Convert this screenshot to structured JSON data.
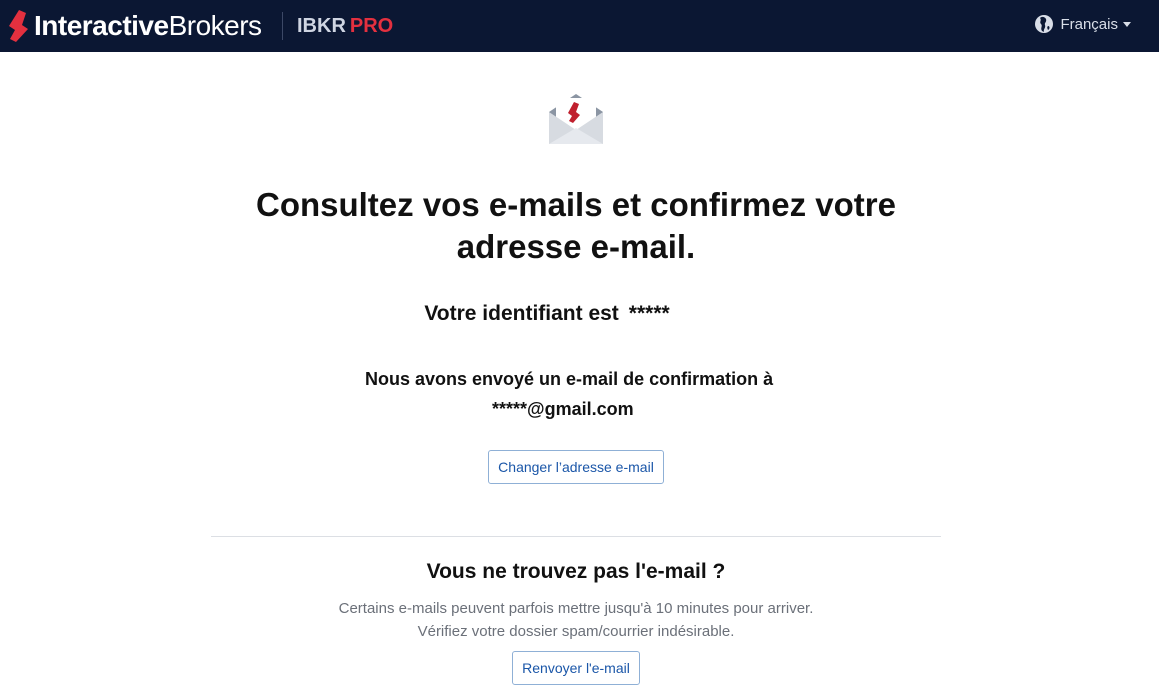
{
  "header": {
    "brand_bold": "Interactive",
    "brand_light": "Brokers",
    "product_name": "IBKR",
    "product_tier": "PRO",
    "language": "Français"
  },
  "main": {
    "headline_line1": "Consultez vos e-mails et confirmez votre",
    "headline_line2": "adresse e-mail.",
    "id_label": "Votre identifiant est",
    "id_value": "*****",
    "sent_text": "Nous avons envoyé un e-mail de confirmation à",
    "email": "*****@gmail.com",
    "change_email_label": "Changer l’adresse e-mail",
    "not_found_title": "Vous ne trouvez pas l'e-mail ?",
    "help_line1": "Certains e-mails peuvent parfois mettre jusqu'à 10 minutes pour arriver.",
    "help_line2": "Vérifiez votre dossier spam/courrier indésirable.",
    "resend_label": "Renvoyer l'e-mail"
  },
  "icons": {
    "logo": "ib-logo-icon",
    "globe": "globe-icon",
    "caret": "chevron-down-icon",
    "envelope": "envelope-icon"
  },
  "colors": {
    "header_bg": "#0b1733",
    "brand_red": "#e3303f",
    "link_blue": "#1a56a8"
  }
}
